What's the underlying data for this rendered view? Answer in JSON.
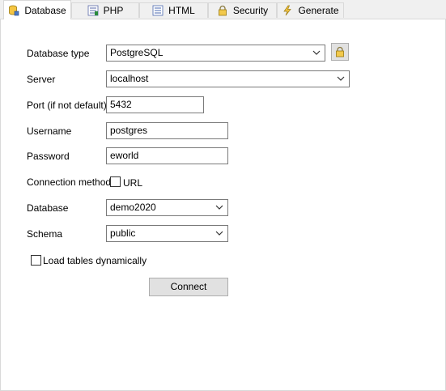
{
  "tabs": [
    {
      "label": "Database",
      "icon": "database-icon",
      "active": true
    },
    {
      "label": "PHP",
      "icon": "php-icon",
      "active": false
    },
    {
      "label": "HTML",
      "icon": "html-icon",
      "active": false
    },
    {
      "label": "Security",
      "icon": "padlock-icon",
      "active": false
    },
    {
      "label": "Generate",
      "icon": "lightning-icon",
      "active": false
    }
  ],
  "form": {
    "db_type": {
      "label": "Database type",
      "value": "PostgreSQL"
    },
    "server": {
      "label": "Server",
      "value": "localhost"
    },
    "port": {
      "label": "Port (if not default)",
      "value": "5432"
    },
    "username": {
      "label": "Username",
      "value": "postgres"
    },
    "password": {
      "label": "Password",
      "value": "eworld"
    },
    "connection_method": {
      "label": "Connection method",
      "option_label": "URL",
      "checked": false
    },
    "database": {
      "label": "Database",
      "value": "demo2020"
    },
    "schema": {
      "label": "Schema",
      "value": "public"
    },
    "load_tables": {
      "label": "Load tables dynamically",
      "checked": false
    },
    "connect_label": "Connect"
  }
}
